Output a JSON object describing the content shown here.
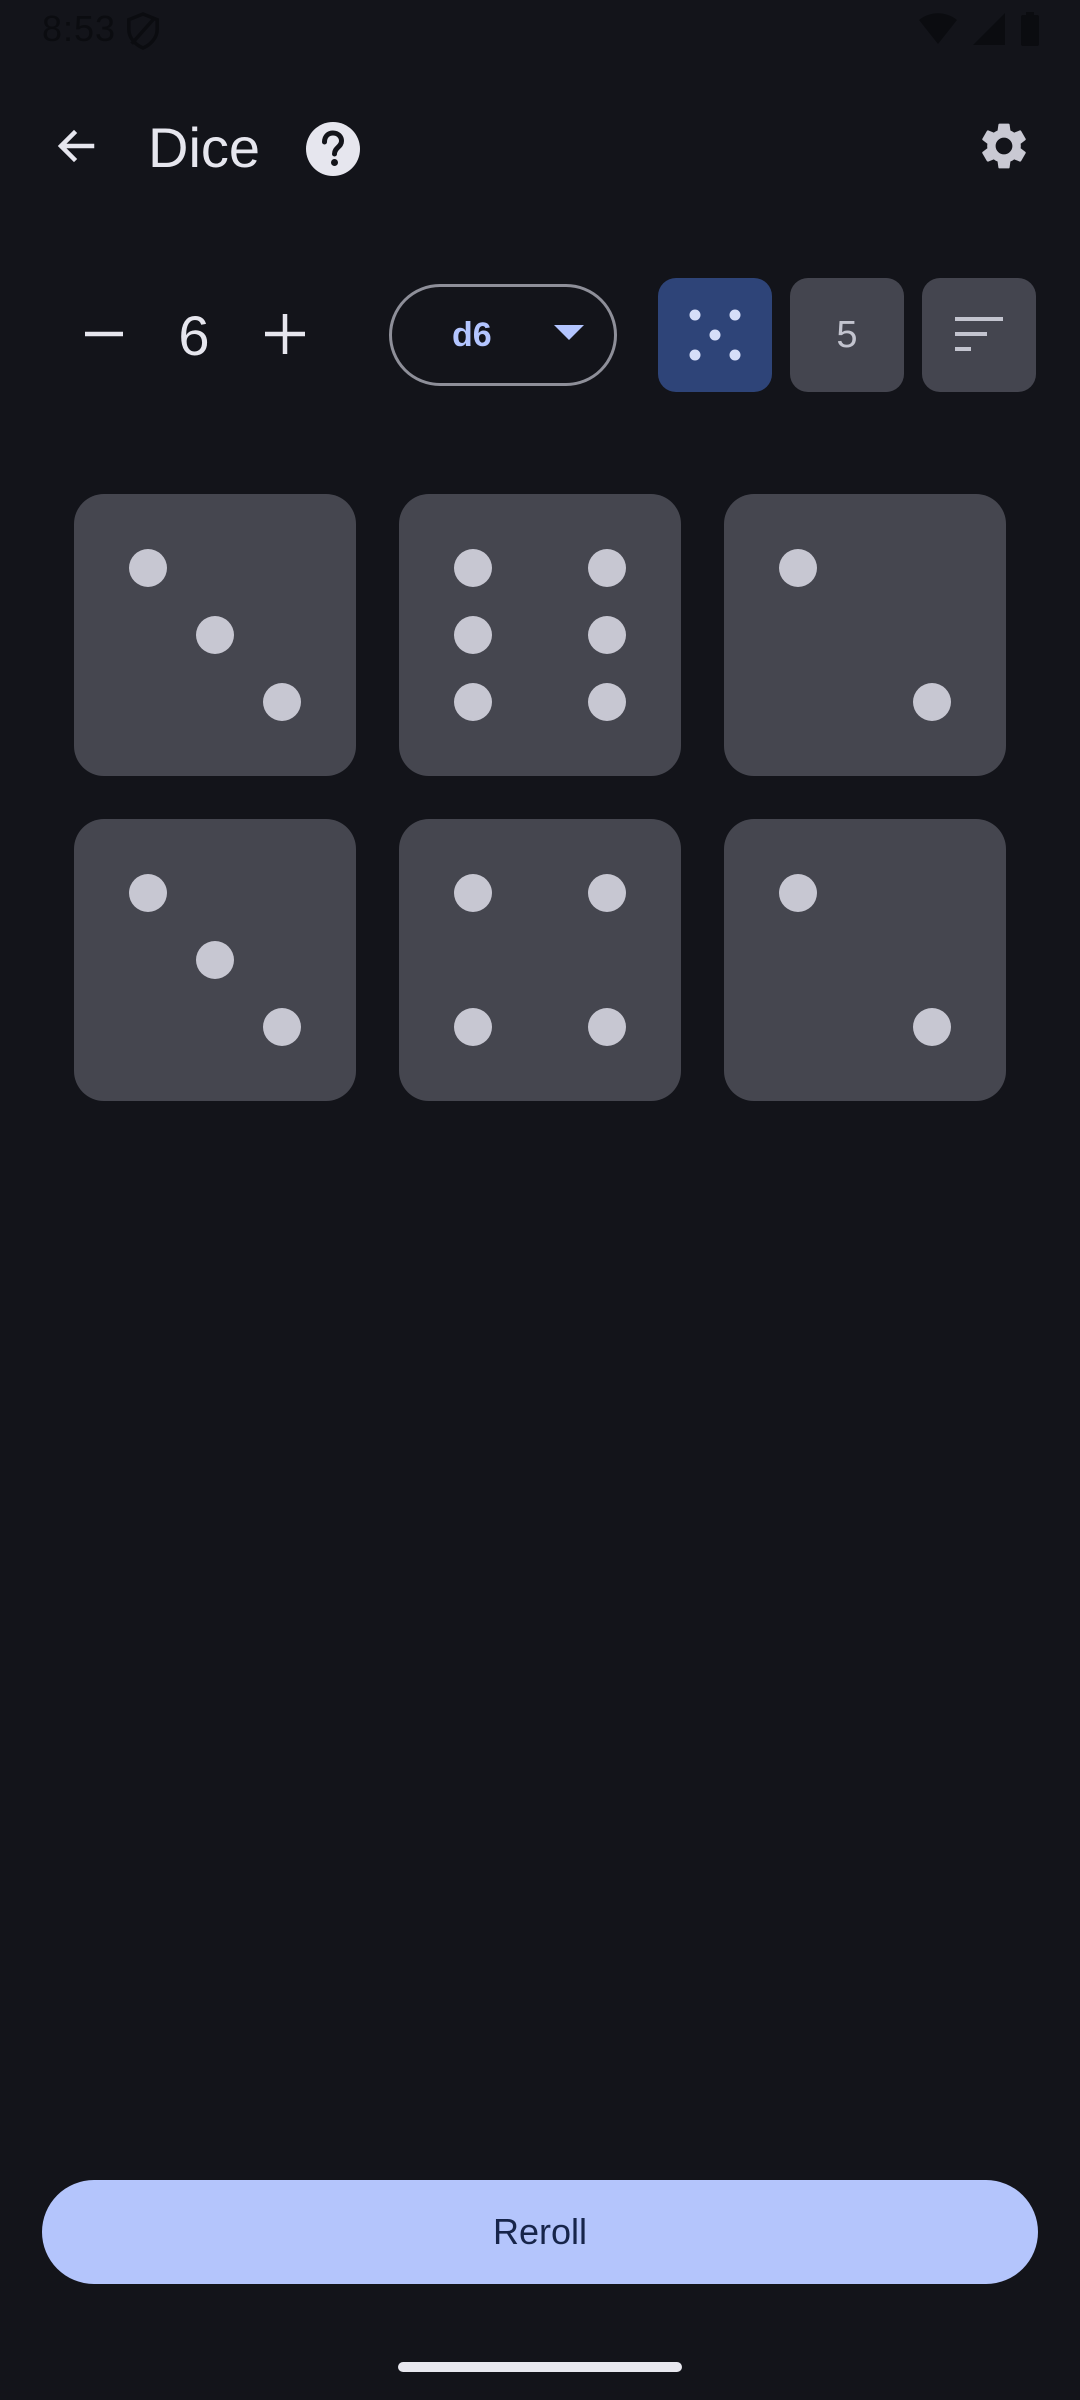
{
  "status_bar": {
    "time": "8:53",
    "icons": [
      "shield-icon",
      "wifi-icon",
      "signal-icon",
      "battery-icon"
    ]
  },
  "app_bar": {
    "title": "Dice",
    "icons": [
      "back-arrow-icon",
      "help-icon",
      "gear-icon"
    ]
  },
  "controls": {
    "dice_count": "6",
    "die_type": "d6",
    "modes": [
      {
        "name": "pips",
        "icon": "dice-pips-icon",
        "selected": true
      },
      {
        "name": "number",
        "label": "5",
        "selected": false
      },
      {
        "name": "sort",
        "icon": "sort-icon",
        "selected": false
      }
    ]
  },
  "dice": [
    3,
    6,
    2,
    3,
    4,
    2
  ],
  "reroll_label": "Reroll",
  "colors": {
    "background": "#13141a",
    "die_face": "#45464f",
    "pip": "#c7c7d2",
    "accent": "#b4c5fc",
    "selected_mode": "#2e4478"
  }
}
